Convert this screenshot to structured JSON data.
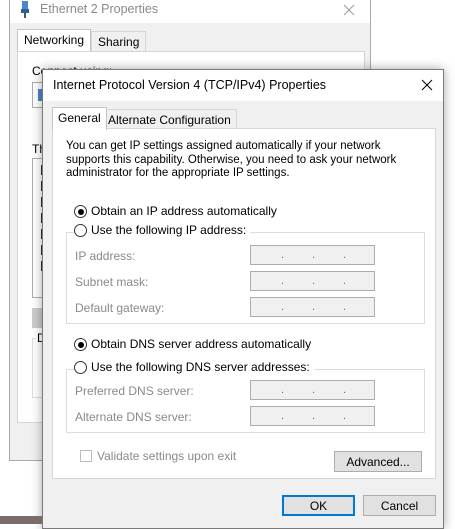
{
  "background_window": {
    "title": "Ethernet 2 Properties",
    "tabs": [
      "Networking",
      "Sharing"
    ],
    "connect_using": "Connect using:",
    "this_connection": "Th",
    "description_label": "D",
    "list_checks": [
      true,
      true,
      true,
      true,
      false,
      true,
      true
    ]
  },
  "dialog": {
    "title": "Internet Protocol Version 4 (TCP/IPv4) Properties",
    "tabs": [
      "General",
      "Alternate Configuration"
    ],
    "intro": "You can get IP settings assigned automatically if your network supports this capability. Otherwise, you need to ask your network administrator for the appropriate IP settings.",
    "ip": {
      "auto_label": "Obtain an IP address automatically",
      "auto_selected": true,
      "manual_label": "Use the following IP address:",
      "manual_selected": false,
      "fields": [
        {
          "label": "IP address:",
          "value": ".  .  ."
        },
        {
          "label": "Subnet mask:",
          "value": ".  .  ."
        },
        {
          "label": "Default gateway:",
          "value": ".  .  ."
        }
      ]
    },
    "dns": {
      "auto_label": "Obtain DNS server address automatically",
      "auto_selected": true,
      "manual_label": "Use the following DNS server addresses:",
      "manual_selected": false,
      "fields": [
        {
          "label": "Preferred DNS server:",
          "value": ".  .  ."
        },
        {
          "label": "Alternate DNS server:",
          "value": ".  .  ."
        }
      ]
    },
    "validate_label": "Validate settings upon exit",
    "validate_checked": false,
    "advanced_button": "Advanced...",
    "ok_button": "OK",
    "cancel_button": "Cancel"
  },
  "colors": {
    "dialog_bg": "#f0f0f0",
    "panel_bg": "#ffffff",
    "disabled_text": "#8a8a8a",
    "accent": "#0078d7"
  }
}
